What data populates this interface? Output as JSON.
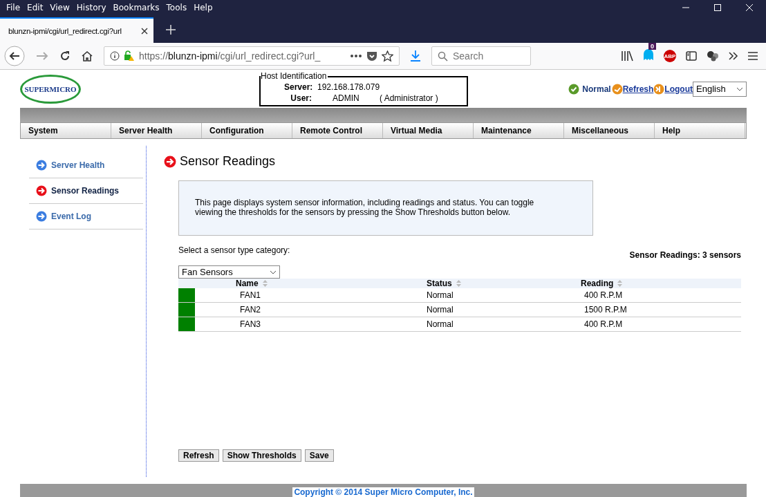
{
  "browser": {
    "menu": [
      "File",
      "Edit",
      "View",
      "History",
      "Bookmarks",
      "Tools",
      "Help"
    ],
    "tab": {
      "title": "blunzn-ipmi/cgi/url_redirect.cgi?url"
    },
    "url": {
      "scheme": "https://",
      "host": "blunzn-ipmi",
      "path": "/cgi/url_redirect.cgi?url_"
    },
    "search": {
      "placeholder": "Search"
    },
    "ghostery_count": "0",
    "abp": "ABP"
  },
  "header": {
    "logo": "SUPERMICRO",
    "host_box": {
      "legend": "Host Identification",
      "server_label": "Server:",
      "server": "192.168.178.079",
      "user_label": "User:",
      "user": "ADMIN",
      "role": "( Administrator )"
    },
    "status": "Normal",
    "refresh": "Refresh",
    "logout": "Logout",
    "language": "English"
  },
  "nav": [
    "System",
    "Server Health",
    "Configuration",
    "Remote Control",
    "Virtual Media",
    "Maintenance",
    "Miscellaneous",
    "Help"
  ],
  "sidebar": [
    {
      "label": "Server Health",
      "selected": false
    },
    {
      "label": "Sensor Readings",
      "selected": true
    },
    {
      "label": "Event Log",
      "selected": false
    }
  ],
  "main": {
    "title": "Sensor Readings",
    "info": "This page displays system sensor information, including readings and status. You can toggle viewing the thresholds for the sensors by pressing the Show Thresholds button below.",
    "select_label": "Select a sensor type category:",
    "count": "Sensor Readings: 3 sensors",
    "category": "Fan Sensors",
    "columns": [
      "Name",
      "Status",
      "Reading"
    ],
    "rows": [
      {
        "color": "#008000",
        "name": "FAN1",
        "status": "Normal",
        "reading": "400 R.P.M"
      },
      {
        "color": "#008000",
        "name": "FAN2",
        "status": "Normal",
        "reading": "1500 R.P.M"
      },
      {
        "color": "#008000",
        "name": "FAN3",
        "status": "Normal",
        "reading": "400 R.P.M"
      }
    ],
    "buttons": [
      "Refresh",
      "Show Thresholds",
      "Save"
    ]
  },
  "footer": "Copyright © 2014 Super Micro Computer, Inc."
}
